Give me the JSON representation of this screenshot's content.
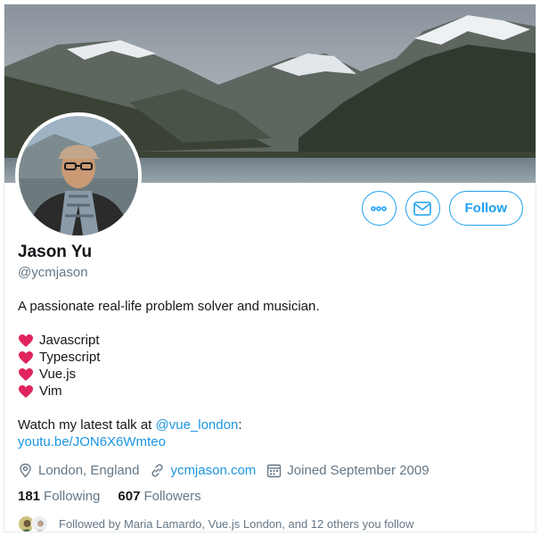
{
  "profile": {
    "name": "Jason Yu",
    "handle": "@ycmjason"
  },
  "actions": {
    "more_icon": "more-horizontal-icon",
    "message_icon": "envelope-icon",
    "follow_label": "Follow"
  },
  "bio": {
    "tagline": "A passionate real-life problem solver and musician.",
    "loves": [
      "Javascript",
      "Typescript",
      "Vue.js",
      "Vim"
    ],
    "talk_prefix": "Watch my latest talk at ",
    "talk_mention": "@vue_london",
    "talk_suffix": ":",
    "talk_link": "youtu.be/JON6X6Wmteo"
  },
  "meta": {
    "location": "London, England",
    "website": "ycmjason.com",
    "joined": "Joined September 2009"
  },
  "stats": {
    "following_count": "181",
    "following_label": "Following",
    "followers_count": "607",
    "followers_label": "Followers"
  },
  "followed_by": {
    "text": "Followed by Maria Lamardo, Vue.js London, and 12 others you follow"
  },
  "colors": {
    "accent": "#1da1f2",
    "link": "#1b95e0",
    "heart": "#e0245e",
    "secondary_text": "#657786"
  }
}
